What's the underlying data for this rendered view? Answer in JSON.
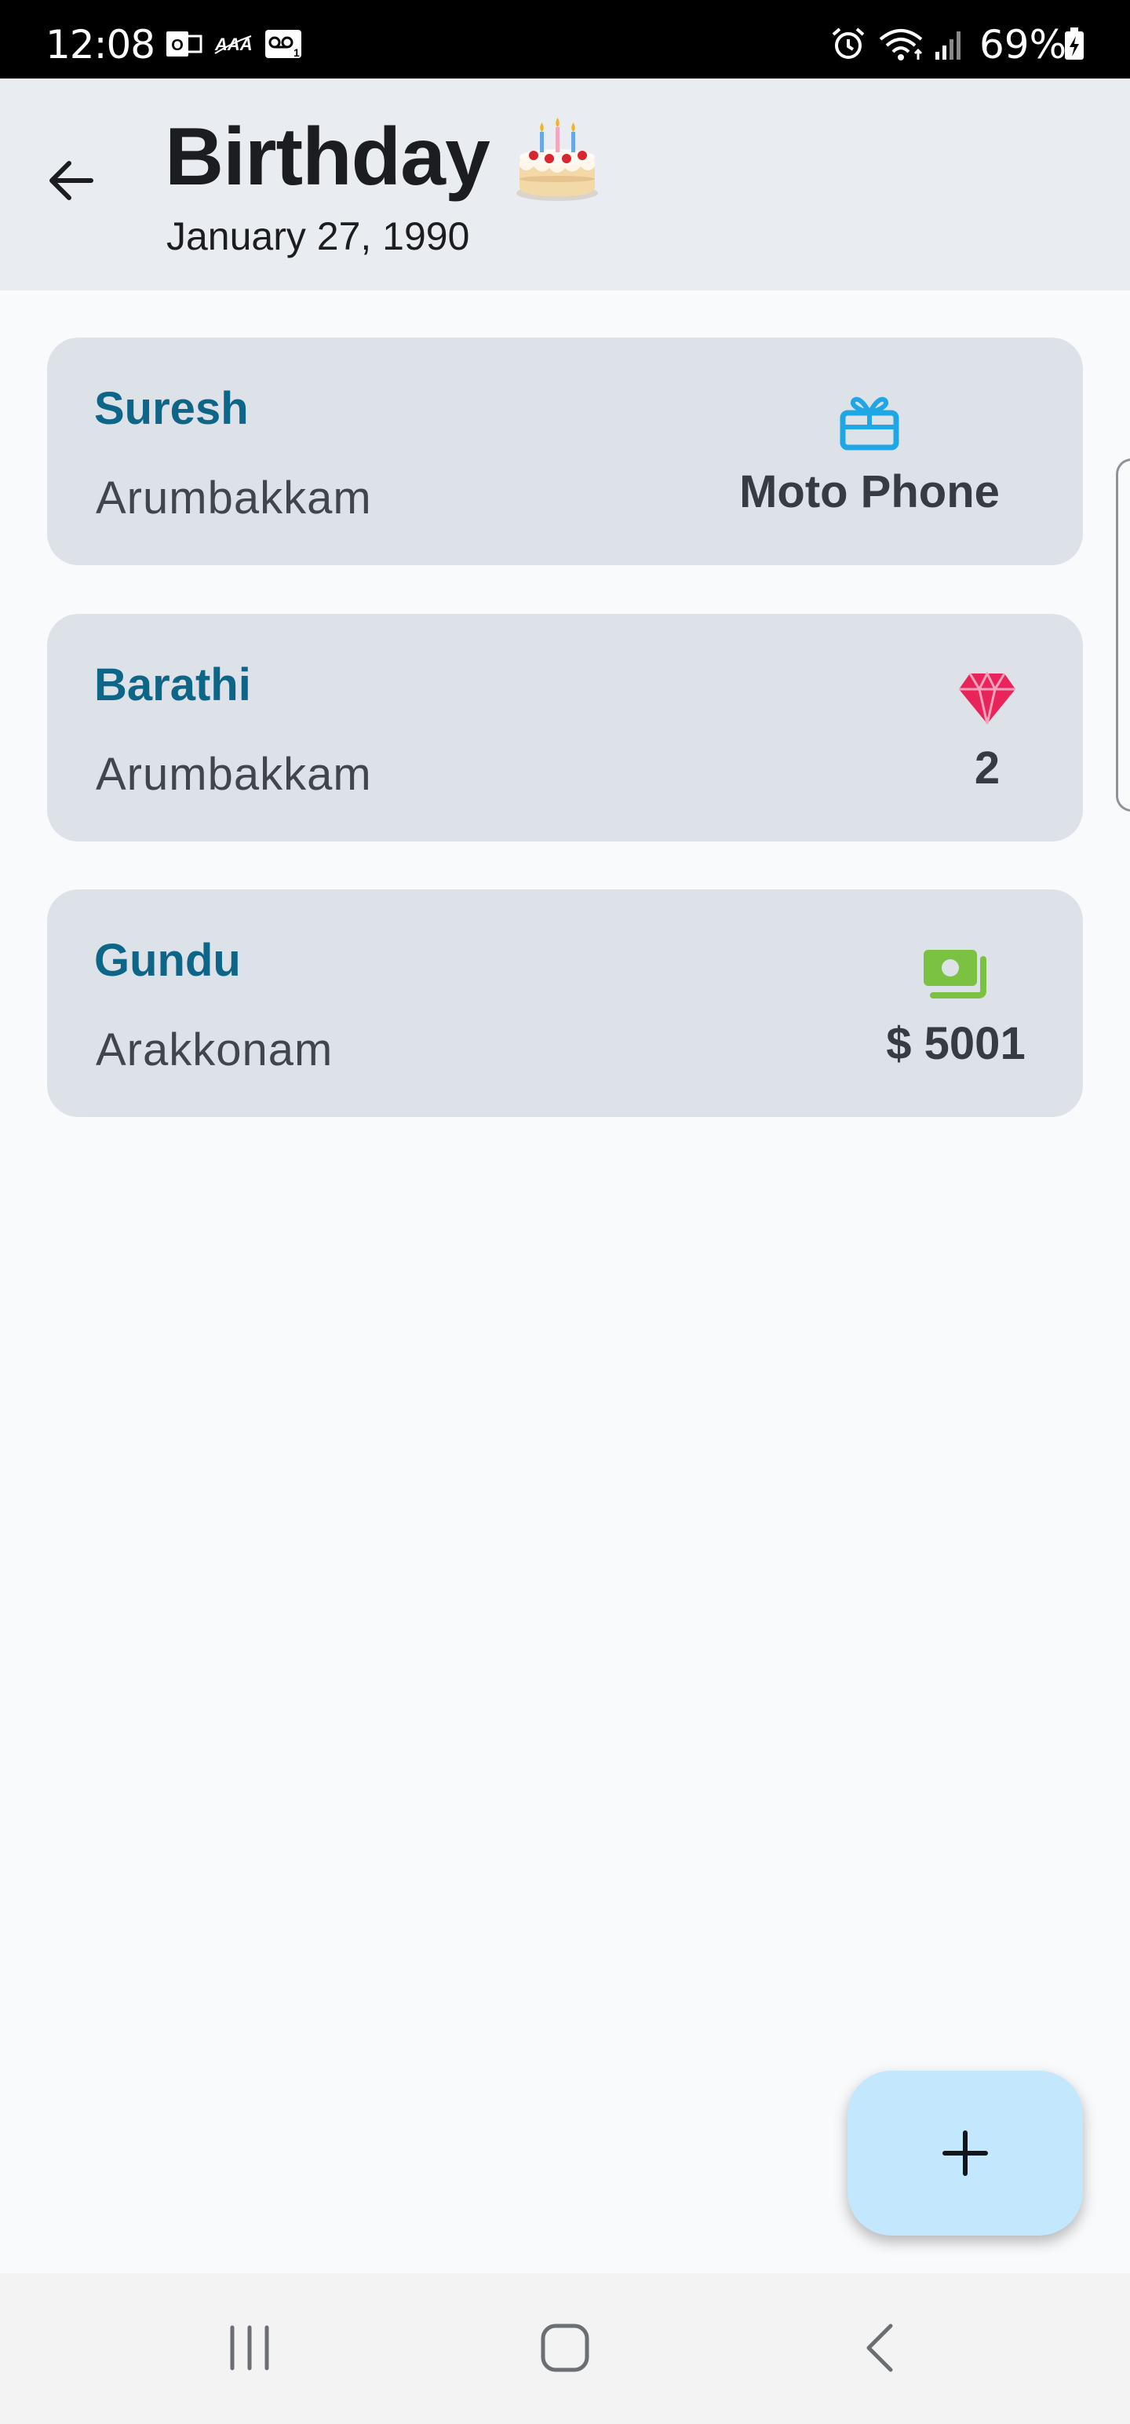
{
  "status_bar": {
    "time": "12:08",
    "battery_percent": "69%",
    "icons": [
      "outlook-icon",
      "aaa-icon",
      "voicemail-icon",
      "alarm-icon",
      "wifi-icon",
      "signal-icon",
      "battery-charging-icon"
    ]
  },
  "header": {
    "title": "Birthday",
    "emoji_icon": "birthday-cake-icon",
    "date": "January 27, 1990"
  },
  "gifts": [
    {
      "name": "Suresh",
      "location": "Arumbakkam",
      "gift_icon": "gift-icon",
      "gift_value": "Moto Phone",
      "icon_color": "#1ea7e4"
    },
    {
      "name": "Barathi",
      "location": "Arumbakkam",
      "gift_icon": "diamond-icon",
      "gift_value": "2",
      "icon_color": "#e8245b"
    },
    {
      "name": "Gundu",
      "location": "Arakkonam",
      "gift_icon": "money-icon",
      "gift_value": "$ 5001",
      "icon_color": "#7cc242"
    }
  ],
  "fab": {
    "icon": "plus-icon"
  },
  "nav_bar": {
    "buttons": [
      "recent-apps-icon",
      "home-icon",
      "back-icon"
    ]
  },
  "colors": {
    "header_bg": "#e9ecf0",
    "card_bg": "#dde2e8",
    "name_color": "#0d6587",
    "fab_bg": "#c3e7fc"
  }
}
